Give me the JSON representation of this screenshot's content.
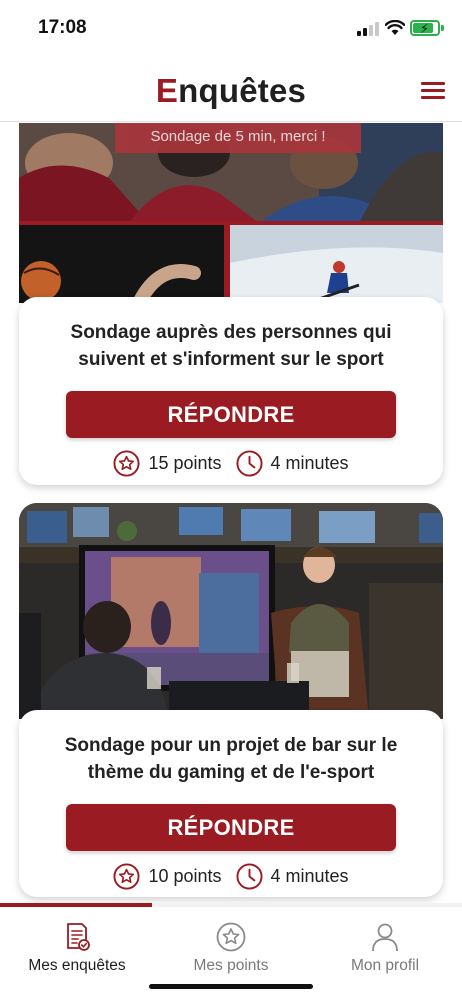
{
  "status_bar": {
    "time": "17:08"
  },
  "header": {
    "title_first": "E",
    "title_rest": "nquêtes",
    "menu_icon": "hamburger-menu-icon"
  },
  "surveys": [
    {
      "banner_text": "Sondage de 5 min, merci !",
      "title": "Sondage auprès des personnes qui suivent et s'informent sur le sport",
      "button_label": "RÉPONDRE",
      "points": "15 points",
      "duration": "4 minutes"
    },
    {
      "title": "Sondage pour un projet de bar sur le thème du gaming et de l'e-sport",
      "button_label": "RÉPONDRE",
      "points": "10 points",
      "duration": "4 minutes"
    }
  ],
  "bottom_nav": {
    "items": [
      {
        "label": "Mes enquêtes",
        "icon": "survey-list-icon",
        "active": true
      },
      {
        "label": "Mes points",
        "icon": "star-icon",
        "active": false
      },
      {
        "label": "Mon profil",
        "icon": "user-icon",
        "active": false
      }
    ],
    "progress": 0.33
  },
  "colors": {
    "accent": "#9b1b22",
    "text": "#1f1f1f",
    "muted": "#7a7a7a"
  }
}
